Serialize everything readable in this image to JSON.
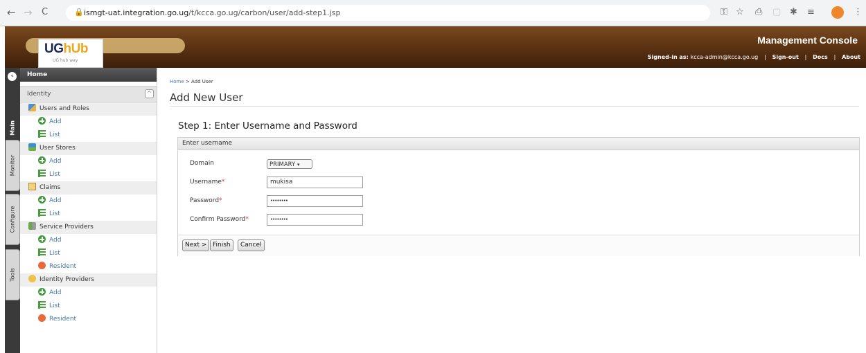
{
  "browser": {
    "back_icon": "←",
    "forward_icon": "→",
    "reload_icon": "C",
    "url_host": "ismgt-uat.integration.go.ug",
    "url_path": "/t/kcca.go.ug/carbon/user/add-step1.jsp",
    "extension_icons": [
      "key-icon",
      "star-icon",
      "printer-icon",
      "square-icon",
      "puzzle-icon",
      "queue-icon"
    ],
    "profile_color": "#f0862a"
  },
  "header": {
    "logo_text_main": "UG",
    "logo_text_accent": "hUb",
    "logo_sub": "UG hub way",
    "title": "Management Console",
    "signed_in_label": "Signed-in as:",
    "signed_in_user": "kcca-admin@kcca.go.ug",
    "links": [
      "Sign-out",
      "Docs",
      "About"
    ]
  },
  "vertical_tabs": [
    "Main",
    "Monitor",
    "Configure",
    "Tools"
  ],
  "sidebar": {
    "home": "Home",
    "section": "Identity",
    "section_toggle": "^",
    "groups": [
      {
        "label": "Users and Roles",
        "items": [
          {
            "label": "Add",
            "icon": "add"
          },
          {
            "label": "List",
            "icon": "list"
          }
        ]
      },
      {
        "label": "User Stores",
        "items": [
          {
            "label": "Add",
            "icon": "add"
          },
          {
            "label": "List",
            "icon": "list"
          }
        ]
      },
      {
        "label": "Claims",
        "items": [
          {
            "label": "Add",
            "icon": "add"
          },
          {
            "label": "List",
            "icon": "list"
          }
        ]
      },
      {
        "label": "Service Providers",
        "items": [
          {
            "label": "Add",
            "icon": "add"
          },
          {
            "label": "List",
            "icon": "list"
          },
          {
            "label": "Resident",
            "icon": "resident"
          }
        ]
      },
      {
        "label": "Identity Providers",
        "items": [
          {
            "label": "Add",
            "icon": "add"
          },
          {
            "label": "List",
            "icon": "list"
          },
          {
            "label": "Resident",
            "icon": "resident"
          }
        ]
      }
    ]
  },
  "main": {
    "breadcrumb_home": "Home",
    "breadcrumb_sep": " > ",
    "breadcrumb_current": "Add User",
    "page_title": "Add New User",
    "step_title": "Step 1: Enter Username and Password",
    "panel_title": "Enter username",
    "form": {
      "domain_label": "Domain",
      "domain_value": "PRIMARY",
      "username_label": "Username",
      "username_value": "mukisa",
      "password_label": "Password",
      "password_value": "••••••••",
      "confirm_label": "Confirm Password",
      "confirm_value": "••••••••",
      "required_mark": "*"
    },
    "buttons": {
      "next": "Next >",
      "finish": "Finish",
      "cancel": "Cancel"
    }
  }
}
